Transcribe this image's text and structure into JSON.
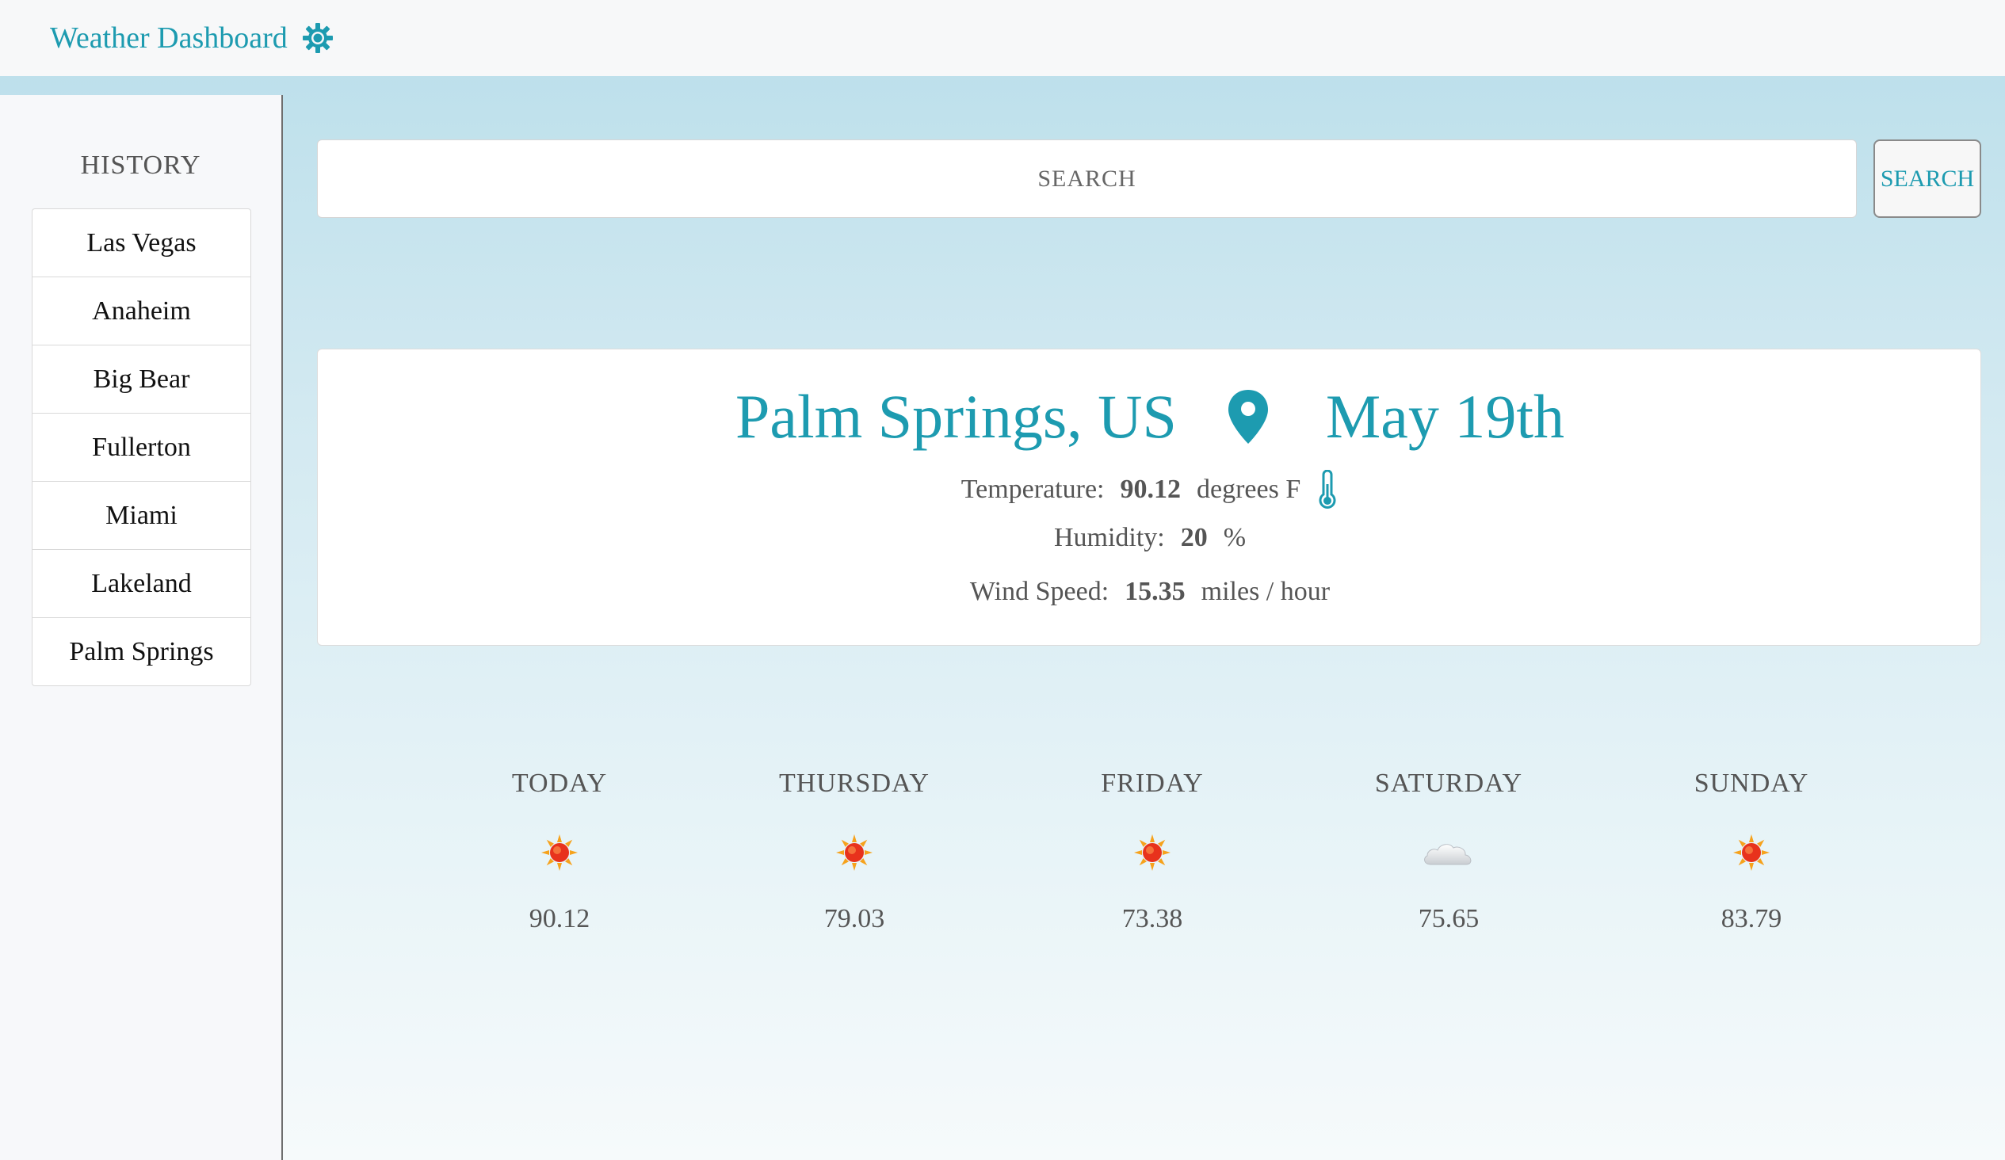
{
  "navbar": {
    "title": "Weather Dashboard",
    "icon": "sun-gear-icon",
    "accent_color": "#1d9bb0"
  },
  "sidebar": {
    "heading": "HISTORY",
    "items": [
      {
        "label": "Las Vegas"
      },
      {
        "label": "Anaheim"
      },
      {
        "label": "Big Bear"
      },
      {
        "label": "Fullerton"
      },
      {
        "label": "Miami"
      },
      {
        "label": "Lakeland"
      },
      {
        "label": "Palm Springs"
      }
    ]
  },
  "search": {
    "placeholder": "SEARCH",
    "button_label": "SEARCH"
  },
  "current": {
    "city": "Palm Springs, US",
    "location_icon": "map-pin-icon",
    "date": "May 19th",
    "temperature_label": "Temperature:",
    "temperature_value": "90.12",
    "temperature_unit": "degrees F",
    "temperature_icon": "thermometer-icon",
    "humidity_label": "Humidity:",
    "humidity_value": "20",
    "humidity_unit": "%",
    "wind_label": "Wind Speed:",
    "wind_value": "15.35",
    "wind_unit": "miles / hour"
  },
  "forecast": [
    {
      "day": "TODAY",
      "icon": "sun-icon",
      "temp": "90.12"
    },
    {
      "day": "THURSDAY",
      "icon": "sun-icon",
      "temp": "79.03"
    },
    {
      "day": "FRIDAY",
      "icon": "sun-icon",
      "temp": "73.38"
    },
    {
      "day": "SATURDAY",
      "icon": "cloud-icon",
      "temp": "75.65"
    },
    {
      "day": "SUNDAY",
      "icon": "sun-icon",
      "temp": "83.79"
    }
  ]
}
